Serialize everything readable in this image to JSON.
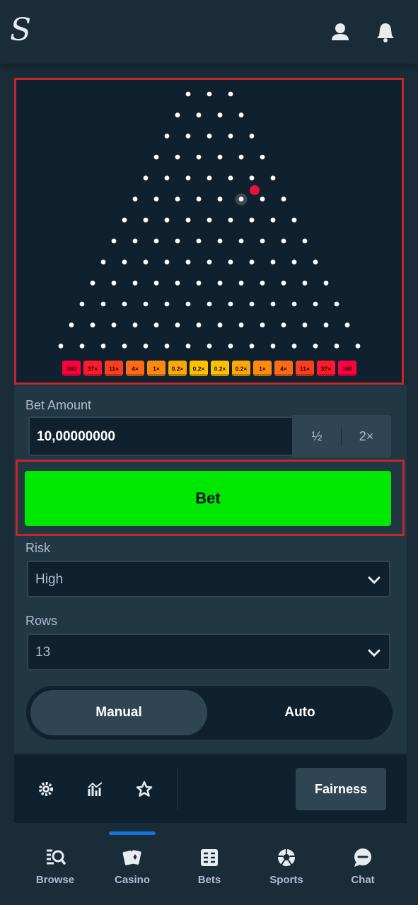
{
  "header": {
    "logo_text": "S",
    "icons": [
      "user-icon",
      "bell-icon"
    ]
  },
  "plinko": {
    "rows": 13,
    "multipliers": [
      "260",
      "37×",
      "11×",
      "4×",
      "1×",
      "0.2×",
      "0.2×",
      "0.2×",
      "0.2×",
      "1×",
      "4×",
      "11×",
      "37×",
      "260"
    ],
    "multiplier_colors": [
      "#ff003f",
      "#fe1a2a",
      "#fe3d1e",
      "#fe6a15",
      "#fe8a0d",
      "#fea706",
      "#ffc000",
      "#ffc000",
      "#fea706",
      "#fe8a0d",
      "#fe6a15",
      "#fe3d1e",
      "#fe1a2a",
      "#ff003f"
    ],
    "ball_color": "#e8123c"
  },
  "bet": {
    "amount_label": "Bet Amount",
    "amount_value": "10,00000000",
    "half_label": "½",
    "double_label": "2×",
    "bet_button_label": "Bet"
  },
  "risk": {
    "label": "Risk",
    "value": "High"
  },
  "rows_select": {
    "label": "Rows",
    "value": "13"
  },
  "mode": {
    "manual_label": "Manual",
    "auto_label": "Auto",
    "selected": "Manual"
  },
  "footer": {
    "icons": [
      "settings-icon",
      "stats-icon",
      "star-icon"
    ],
    "fairness_label": "Fairness"
  },
  "bottom_nav": {
    "items": [
      {
        "label": "Browse",
        "icon": "browse-icon"
      },
      {
        "label": "Casino",
        "icon": "casino-icon"
      },
      {
        "label": "Bets",
        "icon": "bets-icon"
      },
      {
        "label": "Sports",
        "icon": "sports-icon"
      },
      {
        "label": "Chat",
        "icon": "chat-icon"
      }
    ],
    "active": "Casino"
  },
  "colors": {
    "accent_green": "#00e701",
    "bg_dark": "#0f212e",
    "bg_panel": "#213743",
    "highlight_border": "#c1272d"
  }
}
